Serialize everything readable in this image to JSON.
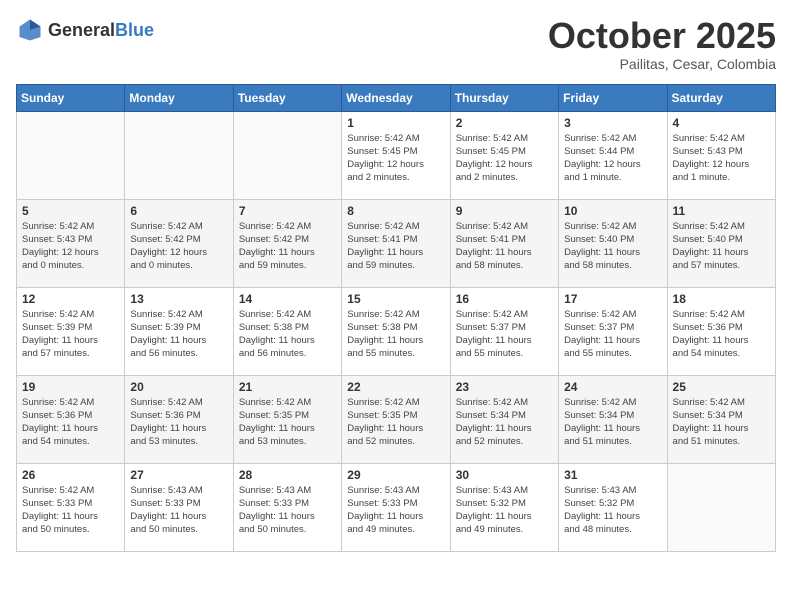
{
  "header": {
    "logo_general": "General",
    "logo_blue": "Blue",
    "month_title": "October 2025",
    "location": "Pailitas, Cesar, Colombia"
  },
  "days_of_week": [
    "Sunday",
    "Monday",
    "Tuesday",
    "Wednesday",
    "Thursday",
    "Friday",
    "Saturday"
  ],
  "weeks": [
    [
      {
        "day": "",
        "info": ""
      },
      {
        "day": "",
        "info": ""
      },
      {
        "day": "",
        "info": ""
      },
      {
        "day": "1",
        "info": "Sunrise: 5:42 AM\nSunset: 5:45 PM\nDaylight: 12 hours\nand 2 minutes."
      },
      {
        "day": "2",
        "info": "Sunrise: 5:42 AM\nSunset: 5:45 PM\nDaylight: 12 hours\nand 2 minutes."
      },
      {
        "day": "3",
        "info": "Sunrise: 5:42 AM\nSunset: 5:44 PM\nDaylight: 12 hours\nand 1 minute."
      },
      {
        "day": "4",
        "info": "Sunrise: 5:42 AM\nSunset: 5:43 PM\nDaylight: 12 hours\nand 1 minute."
      }
    ],
    [
      {
        "day": "5",
        "info": "Sunrise: 5:42 AM\nSunset: 5:43 PM\nDaylight: 12 hours\nand 0 minutes."
      },
      {
        "day": "6",
        "info": "Sunrise: 5:42 AM\nSunset: 5:42 PM\nDaylight: 12 hours\nand 0 minutes."
      },
      {
        "day": "7",
        "info": "Sunrise: 5:42 AM\nSunset: 5:42 PM\nDaylight: 11 hours\nand 59 minutes."
      },
      {
        "day": "8",
        "info": "Sunrise: 5:42 AM\nSunset: 5:41 PM\nDaylight: 11 hours\nand 59 minutes."
      },
      {
        "day": "9",
        "info": "Sunrise: 5:42 AM\nSunset: 5:41 PM\nDaylight: 11 hours\nand 58 minutes."
      },
      {
        "day": "10",
        "info": "Sunrise: 5:42 AM\nSunset: 5:40 PM\nDaylight: 11 hours\nand 58 minutes."
      },
      {
        "day": "11",
        "info": "Sunrise: 5:42 AM\nSunset: 5:40 PM\nDaylight: 11 hours\nand 57 minutes."
      }
    ],
    [
      {
        "day": "12",
        "info": "Sunrise: 5:42 AM\nSunset: 5:39 PM\nDaylight: 11 hours\nand 57 minutes."
      },
      {
        "day": "13",
        "info": "Sunrise: 5:42 AM\nSunset: 5:39 PM\nDaylight: 11 hours\nand 56 minutes."
      },
      {
        "day": "14",
        "info": "Sunrise: 5:42 AM\nSunset: 5:38 PM\nDaylight: 11 hours\nand 56 minutes."
      },
      {
        "day": "15",
        "info": "Sunrise: 5:42 AM\nSunset: 5:38 PM\nDaylight: 11 hours\nand 55 minutes."
      },
      {
        "day": "16",
        "info": "Sunrise: 5:42 AM\nSunset: 5:37 PM\nDaylight: 11 hours\nand 55 minutes."
      },
      {
        "day": "17",
        "info": "Sunrise: 5:42 AM\nSunset: 5:37 PM\nDaylight: 11 hours\nand 55 minutes."
      },
      {
        "day": "18",
        "info": "Sunrise: 5:42 AM\nSunset: 5:36 PM\nDaylight: 11 hours\nand 54 minutes."
      }
    ],
    [
      {
        "day": "19",
        "info": "Sunrise: 5:42 AM\nSunset: 5:36 PM\nDaylight: 11 hours\nand 54 minutes."
      },
      {
        "day": "20",
        "info": "Sunrise: 5:42 AM\nSunset: 5:36 PM\nDaylight: 11 hours\nand 53 minutes."
      },
      {
        "day": "21",
        "info": "Sunrise: 5:42 AM\nSunset: 5:35 PM\nDaylight: 11 hours\nand 53 minutes."
      },
      {
        "day": "22",
        "info": "Sunrise: 5:42 AM\nSunset: 5:35 PM\nDaylight: 11 hours\nand 52 minutes."
      },
      {
        "day": "23",
        "info": "Sunrise: 5:42 AM\nSunset: 5:34 PM\nDaylight: 11 hours\nand 52 minutes."
      },
      {
        "day": "24",
        "info": "Sunrise: 5:42 AM\nSunset: 5:34 PM\nDaylight: 11 hours\nand 51 minutes."
      },
      {
        "day": "25",
        "info": "Sunrise: 5:42 AM\nSunset: 5:34 PM\nDaylight: 11 hours\nand 51 minutes."
      }
    ],
    [
      {
        "day": "26",
        "info": "Sunrise: 5:42 AM\nSunset: 5:33 PM\nDaylight: 11 hours\nand 50 minutes."
      },
      {
        "day": "27",
        "info": "Sunrise: 5:43 AM\nSunset: 5:33 PM\nDaylight: 11 hours\nand 50 minutes."
      },
      {
        "day": "28",
        "info": "Sunrise: 5:43 AM\nSunset: 5:33 PM\nDaylight: 11 hours\nand 50 minutes."
      },
      {
        "day": "29",
        "info": "Sunrise: 5:43 AM\nSunset: 5:33 PM\nDaylight: 11 hours\nand 49 minutes."
      },
      {
        "day": "30",
        "info": "Sunrise: 5:43 AM\nSunset: 5:32 PM\nDaylight: 11 hours\nand 49 minutes."
      },
      {
        "day": "31",
        "info": "Sunrise: 5:43 AM\nSunset: 5:32 PM\nDaylight: 11 hours\nand 48 minutes."
      },
      {
        "day": "",
        "info": ""
      }
    ]
  ]
}
